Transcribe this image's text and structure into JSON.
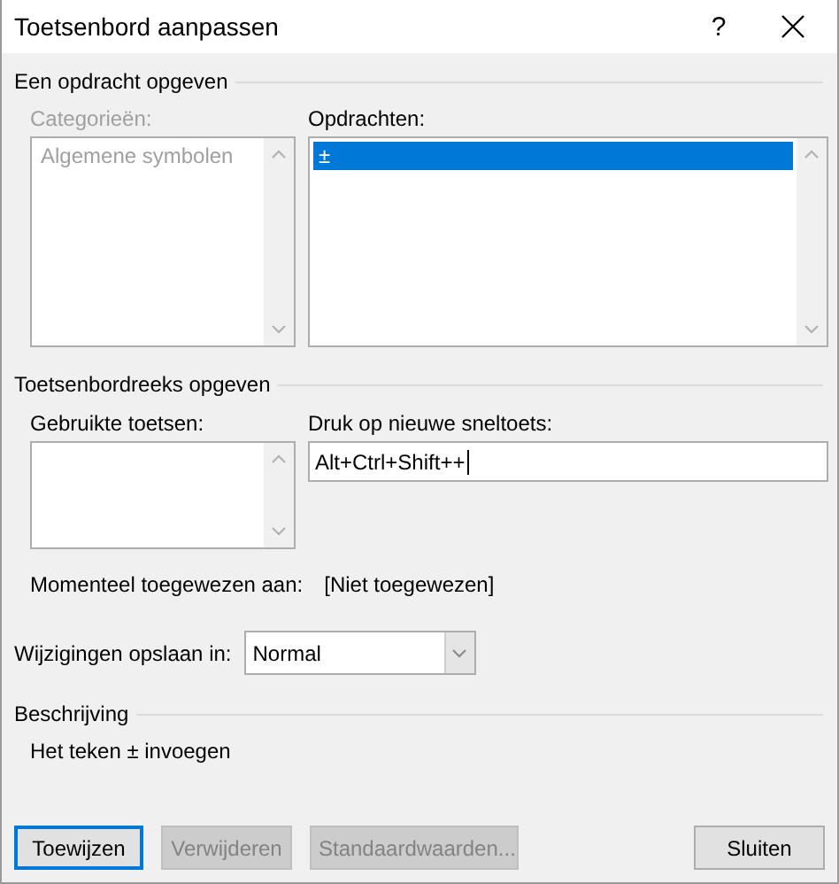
{
  "window": {
    "title": "Toetsenbord aanpassen",
    "help": "?"
  },
  "command_section": {
    "heading": "Een opdracht opgeven",
    "categories": {
      "label": "Categorieën:",
      "disabled": true,
      "items": [
        {
          "text": "Algemene symbolen",
          "selected": false
        }
      ]
    },
    "commands": {
      "label": "Opdrachten:",
      "disabled": false,
      "items": [
        {
          "text": "±",
          "selected": true
        }
      ]
    }
  },
  "keys_section": {
    "heading": "Toetsenbordreeks opgeven",
    "current_keys": {
      "label": "Gebruikte toetsen:"
    },
    "new_shortcut": {
      "label": "Druk op nieuwe sneltoets:",
      "value": "Alt+Ctrl+Shift++"
    },
    "assigned": {
      "label": "Momenteel toegewezen aan:",
      "value": "[Niet toegewezen]"
    }
  },
  "save_in": {
    "label": "Wijzigingen opslaan in:",
    "value": "Normal"
  },
  "description": {
    "heading": "Beschrijving",
    "text": "Het teken ± invoegen"
  },
  "buttons": [
    {
      "label": "Toewijzen",
      "disabled": false,
      "default": true
    },
    {
      "label": "Verwijderen",
      "disabled": true,
      "default": false
    },
    {
      "label": "Standaardwaarden...",
      "disabled": true,
      "default": false
    },
    {
      "label": "Sluiten",
      "disabled": false,
      "default": false
    }
  ]
}
